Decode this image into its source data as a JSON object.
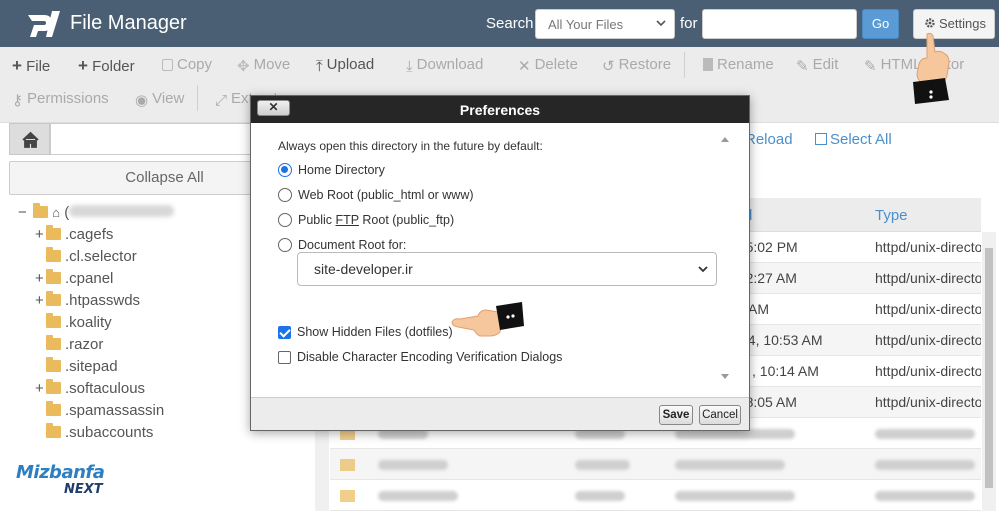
{
  "header": {
    "app_title": "File Manager",
    "search_label": "Search",
    "search_scope": "All Your Files",
    "for_label": "for",
    "search_value": "",
    "go_label": "Go",
    "settings_label": "Settings"
  },
  "toolbar": {
    "row1": [
      {
        "label": "File",
        "icon": "plus-icon",
        "disabled": false
      },
      {
        "label": "Folder",
        "icon": "plus-icon",
        "disabled": false
      },
      {
        "label": "Copy",
        "icon": "copy-icon",
        "disabled": true
      },
      {
        "label": "Move",
        "icon": "move-icon",
        "disabled": true
      },
      {
        "label": "Upload",
        "icon": "upload-icon",
        "disabled": false
      },
      {
        "label": "Download",
        "icon": "download-icon",
        "disabled": true
      },
      {
        "label": "Delete",
        "icon": "delete-icon",
        "disabled": true
      },
      {
        "label": "Restore",
        "icon": "restore-icon",
        "disabled": true
      },
      {
        "label": "Rename",
        "icon": "file-icon",
        "disabled": true
      },
      {
        "label": "Edit",
        "icon": "pencil-icon",
        "disabled": true
      },
      {
        "label": "HTML Editor",
        "icon": "html-editor-icon",
        "disabled": true
      }
    ],
    "row2": [
      {
        "label": "Permissions",
        "icon": "key-icon",
        "disabled": true
      },
      {
        "label": "View",
        "icon": "eye-icon",
        "disabled": true
      },
      {
        "label": "Extract",
        "icon": "expand-icon",
        "disabled": true
      }
    ]
  },
  "sidebar": {
    "collapse_label": "Collapse All",
    "root_prefix": "(",
    "tree": [
      {
        "name": ".cagefs",
        "expandable": true
      },
      {
        "name": ".cl.selector",
        "expandable": false
      },
      {
        "name": ".cpanel",
        "expandable": true
      },
      {
        "name": ".htpasswds",
        "expandable": true
      },
      {
        "name": ".koality",
        "expandable": false
      },
      {
        "name": ".razor",
        "expandable": false
      },
      {
        "name": ".sitepad",
        "expandable": false
      },
      {
        "name": ".softaculous",
        "expandable": true
      },
      {
        "name": ".spamassassin",
        "expandable": false
      },
      {
        "name": ".subaccounts",
        "expandable": false
      }
    ]
  },
  "file_pane": {
    "reload_label": "Reload",
    "select_all_label": "Select All",
    "columns": {
      "modified": "d",
      "type": "Type"
    },
    "rows": [
      {
        "modified": "4, 5:02 PM",
        "type": "httpd/unix-directory"
      },
      {
        "modified": "4, 2:27 AM",
        "type": "httpd/unix-directory"
      },
      {
        "modified": "AM",
        "type": "httpd/unix-directory"
      },
      {
        "modified": "24, 10:53 AM",
        "type": "httpd/unix-directory"
      },
      {
        "modified": ", 10:14 AM",
        "type": "httpd/unix-directory"
      },
      {
        "modified": "4, 8:05 AM",
        "type": "httpd/unix-directory"
      }
    ]
  },
  "dialog": {
    "title": "Preferences",
    "close_label": "✕",
    "intro": "Always open this directory in the future by default:",
    "options": [
      {
        "label": "Home Directory",
        "selected": true
      },
      {
        "label": "Web Root (public_html or www)",
        "selected": false
      },
      {
        "label_pre": "Public ",
        "label_u": "FTP",
        "label_post": " Root (public_ftp)",
        "selected": false
      },
      {
        "label": "Document Root for:",
        "selected": false
      }
    ],
    "doc_root_value": "site-developer.ir",
    "checkboxes": [
      {
        "label": "Show Hidden Files (dotfiles)",
        "checked": true
      },
      {
        "label": "Disable Character Encoding Verification Dialogs",
        "checked": false
      }
    ],
    "save_label": "Save",
    "cancel_label": "Cancel"
  },
  "branding": {
    "top": "Mizbanfa",
    "bottom": "NEXT"
  },
  "colors": {
    "header_bg": "#4b5f74",
    "accent": "#4b8fcb",
    "radio_active": "#1a73e8",
    "folder": "#e9bb5c"
  }
}
